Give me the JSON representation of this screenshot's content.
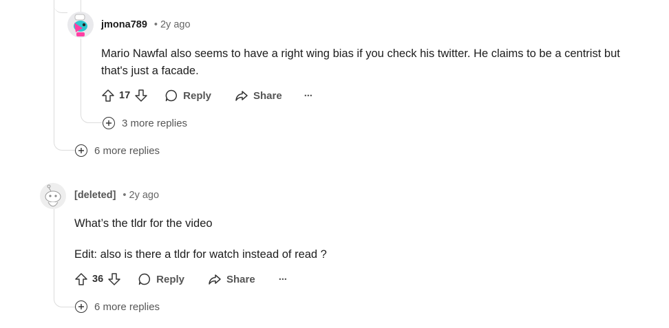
{
  "comments": [
    {
      "author": "jmona789",
      "separator": "•",
      "age": "2y ago",
      "body_lines": [
        "Mario Nawfal also seems to have a right wing bias if you check his twitter. He claims to be a centrist but",
        "that's just a facade."
      ],
      "votes": "17",
      "reply_label": "Reply",
      "share_label": "Share",
      "overflow_label": "···",
      "more_replies": "3 more replies"
    },
    {
      "more_replies": "6 more replies"
    },
    {
      "author": "[deleted]",
      "separator": "•",
      "age": "2y ago",
      "body_paragraphs": [
        "What’s the tldr for the video",
        "Edit: also is there a tldr for watch instead of read ?"
      ],
      "votes": "36",
      "reply_label": "Reply",
      "share_label": "Share",
      "overflow_label": "···",
      "more_replies": "6 more replies"
    }
  ],
  "colors": {
    "thread_line": "#dcdcdc",
    "avatar_accent_1": "#2fc7cf",
    "avatar_accent_2": "#ff3fa4"
  }
}
